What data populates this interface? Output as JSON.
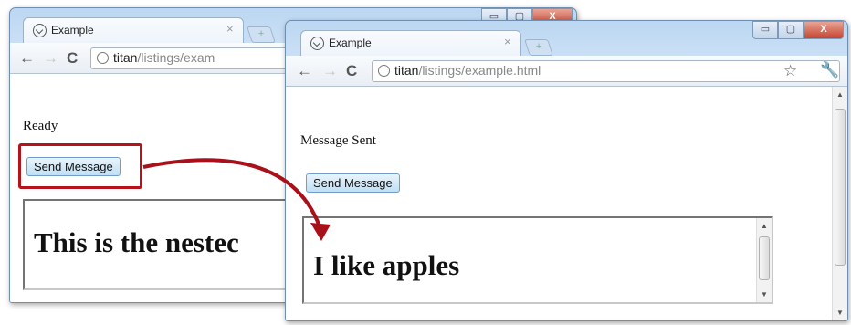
{
  "back_window": {
    "tab_title": "Example",
    "tab_close": "×",
    "url_host": "titan",
    "url_path": "/listings/exam",
    "status_text": "Ready",
    "send_button_label": "Send Message",
    "iframe_text": "This is the nestec"
  },
  "front_window": {
    "tab_title": "Example",
    "tab_close": "×",
    "url_host": "titan",
    "url_path": "/listings/example.html",
    "status_text": "Message Sent",
    "send_button_label": "Send Message",
    "iframe_text": "I like apples"
  },
  "window_controls": {
    "minimize": "▭",
    "maximize": "▢",
    "close": "X"
  },
  "toolbar": {
    "back": "←",
    "forward": "→",
    "reload": "C",
    "star": "☆",
    "wrench": "🔧"
  },
  "icons": {
    "page_icon": "globe-icon",
    "newtab": "+"
  },
  "colors": {
    "callout_red": "#b5121b",
    "arrow_red": "#a8101a"
  }
}
